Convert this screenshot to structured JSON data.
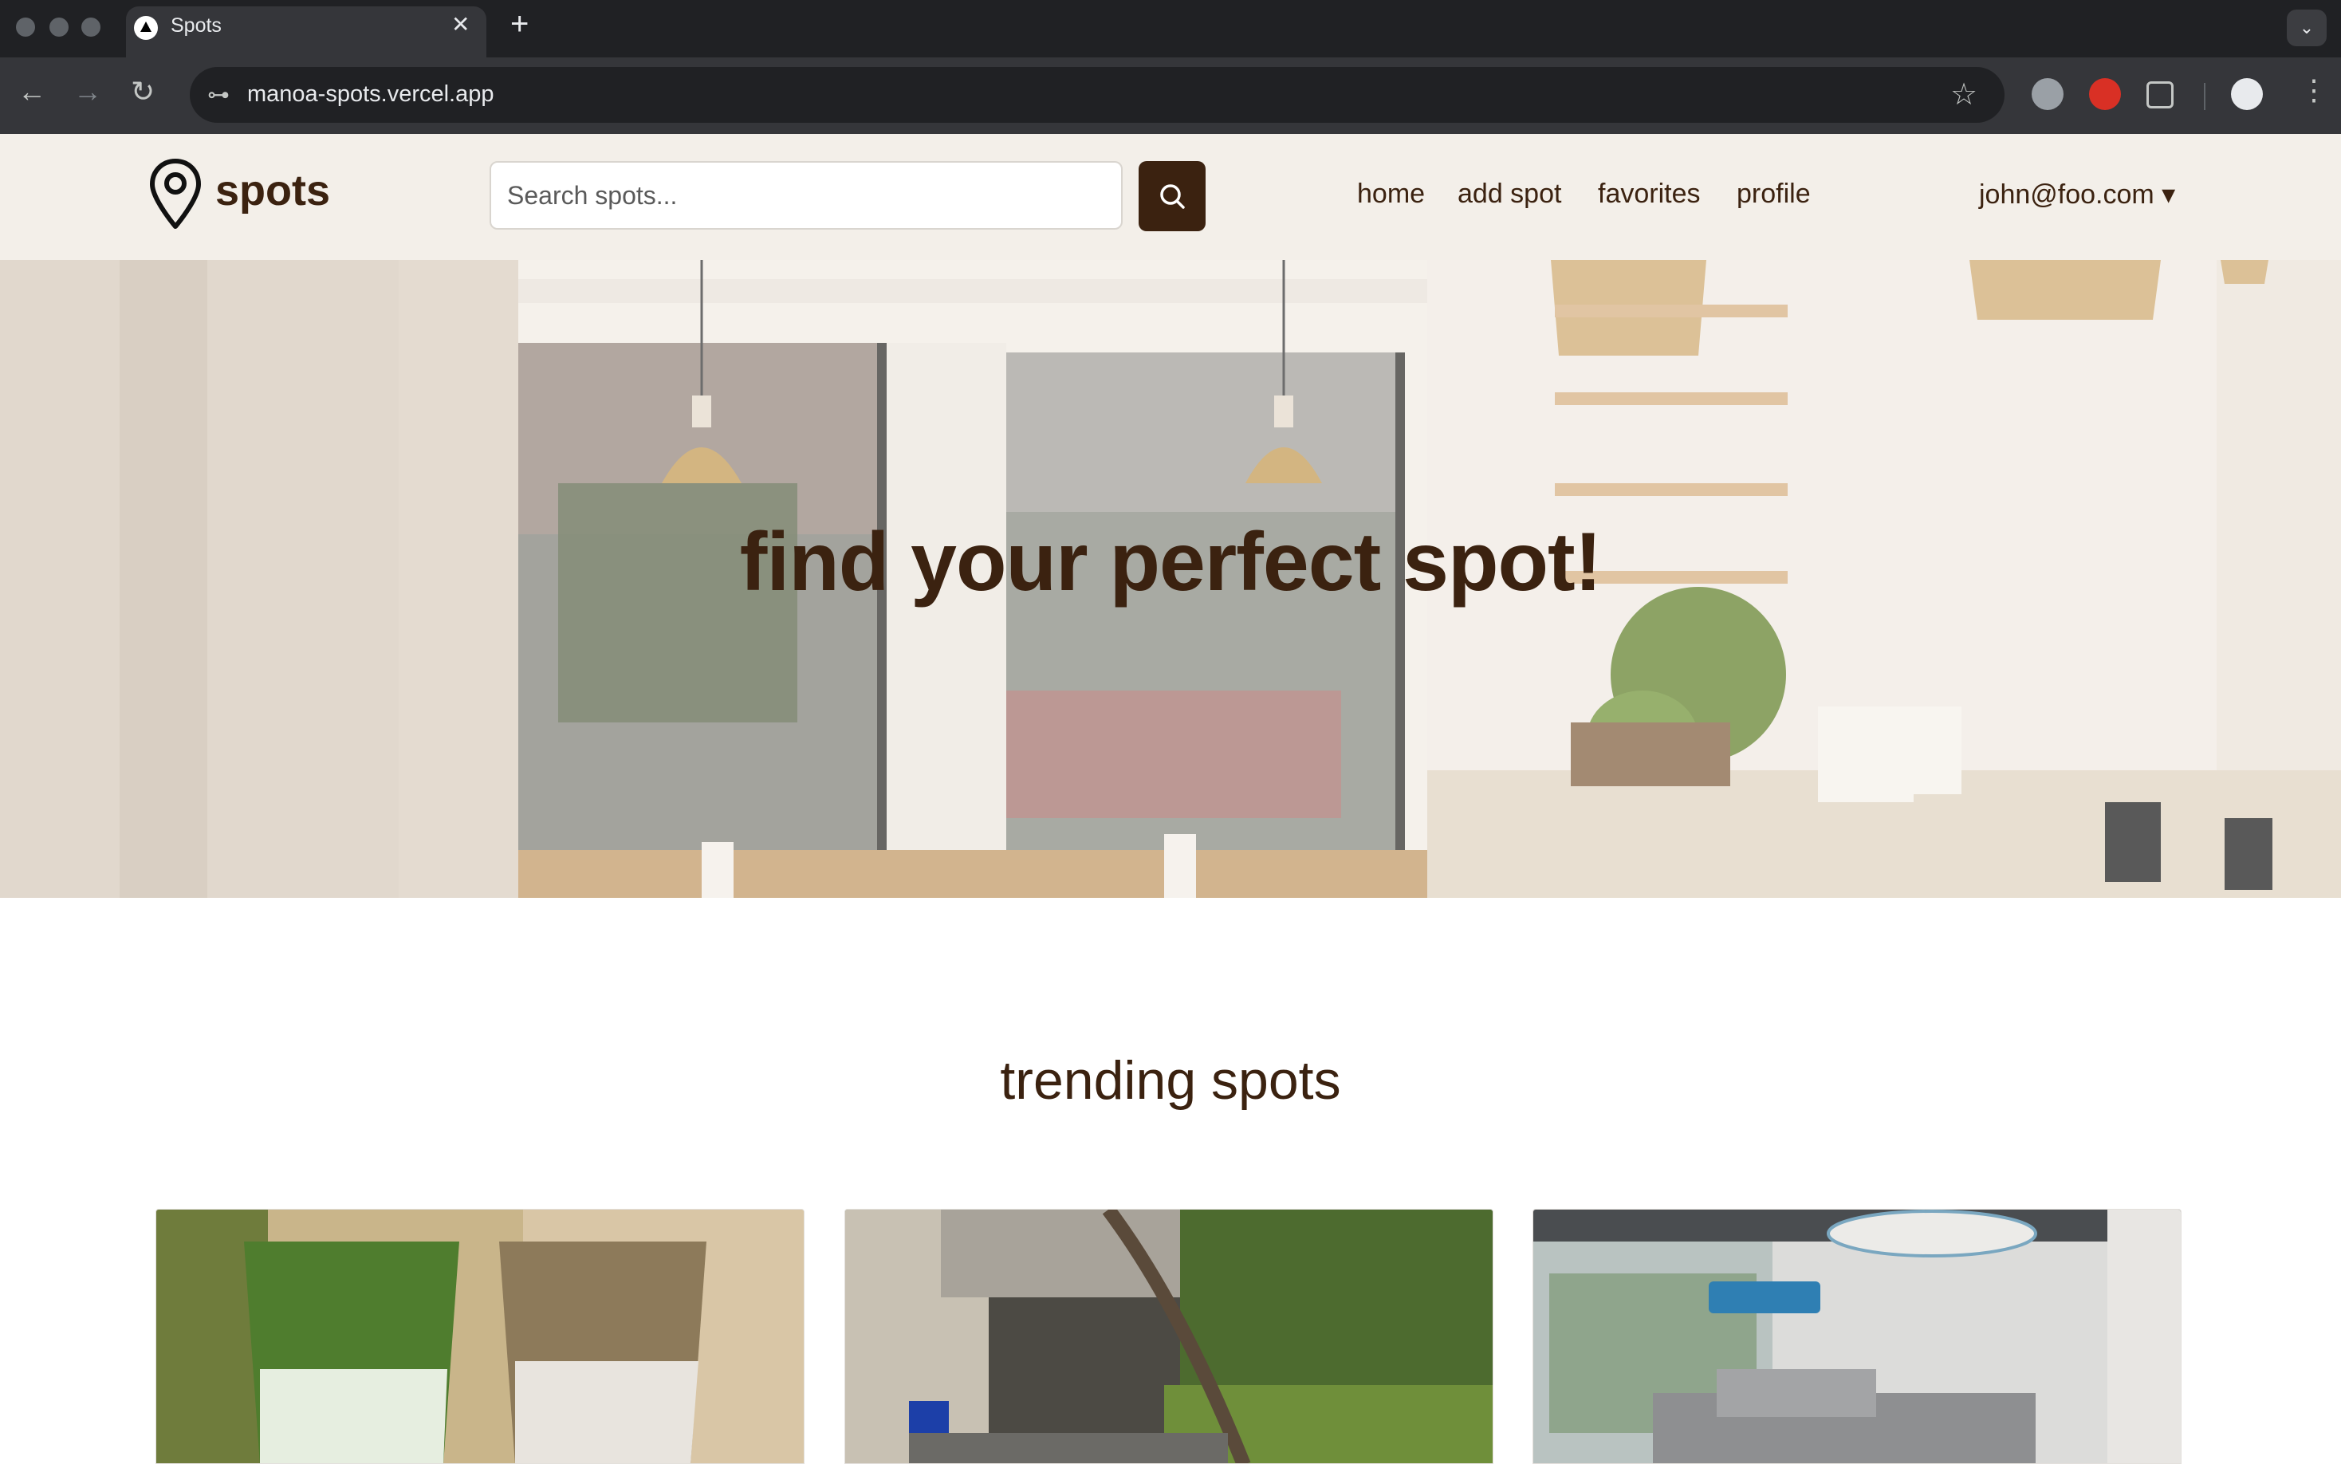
{
  "browser": {
    "tab_title": "Spots",
    "tab_close": "✕",
    "new_tab": "+",
    "tab_menu": "⌄",
    "back": "←",
    "forward": "→",
    "reload": "↻",
    "site_info": "⊶",
    "url": "manoa-spots.vercel.app",
    "bookmark": "☆",
    "menu": "⋮"
  },
  "navbar": {
    "brand": "spots",
    "search_placeholder": "Search spots...",
    "links": [
      "home",
      "add spot",
      "favorites",
      "profile"
    ],
    "user": "john@foo.com ▾"
  },
  "hero": {
    "title": "find your perfect spot!"
  },
  "trending": {
    "title": "trending spots"
  },
  "colors": {
    "brand_brown": "#3b2210",
    "navbar_bg": "#f3efe9"
  }
}
